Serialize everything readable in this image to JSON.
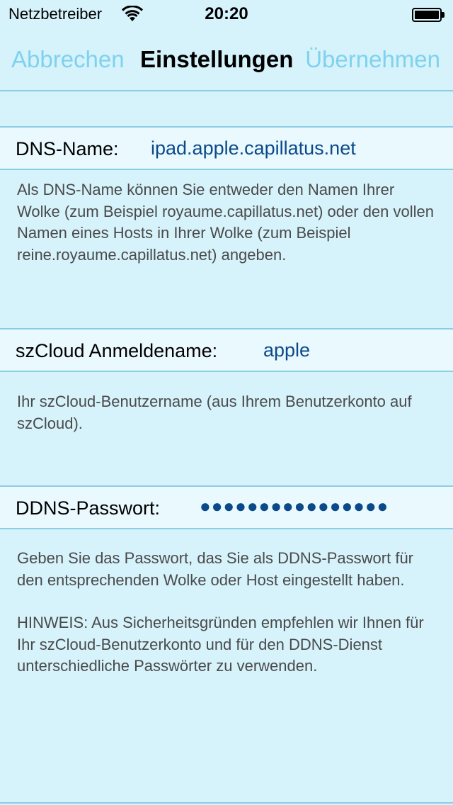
{
  "status_bar": {
    "carrier": "Netzbetreiber",
    "time": "20:20",
    "battery_level": 1.0
  },
  "nav": {
    "cancel_label": "Abbrechen",
    "title": "Einstellungen",
    "apply_label": "Übernehmen"
  },
  "fields": {
    "dns": {
      "label": "DNS-Name:",
      "value": "ipad.apple.capillatus.net",
      "help": "Als DNS-Name können Sie entweder den Namen Ihrer Wolke (zum Beispiel royaume.capillatus.net) oder den vollen Namen eines Hosts in Ihrer Wolke (zum Beispiel reine.royaume.capillatus.net) angeben."
    },
    "login": {
      "label": "szCloud Anmeldename:",
      "value": "apple",
      "help": "Ihr szCloud-Benutzername (aus Ihrem Benutzerkonto auf szCloud)."
    },
    "password": {
      "label": "DDNS-Passwort:",
      "value": "●●●●●●●●●●●●●●●●",
      "help": "Geben Sie das Passwort, das Sie als DDNS-Passwort für den entsprechenden Wolke oder Host eingestellt haben.",
      "note": "HINWEIS: Aus Sicherheitsgründen empfehlen wir Ihnen für Ihr szCloud-Benutzerkonto und für den DDNS-Dienst unterschiedliche Passwörter zu verwenden."
    }
  },
  "colors": {
    "background": "#d6f2fb",
    "row_background": "#eaf9fe",
    "separator": "#8ccde6",
    "nav_button": "#7fd2ee",
    "field_value": "#0b4a8a",
    "help_text": "#4a4a4a"
  }
}
